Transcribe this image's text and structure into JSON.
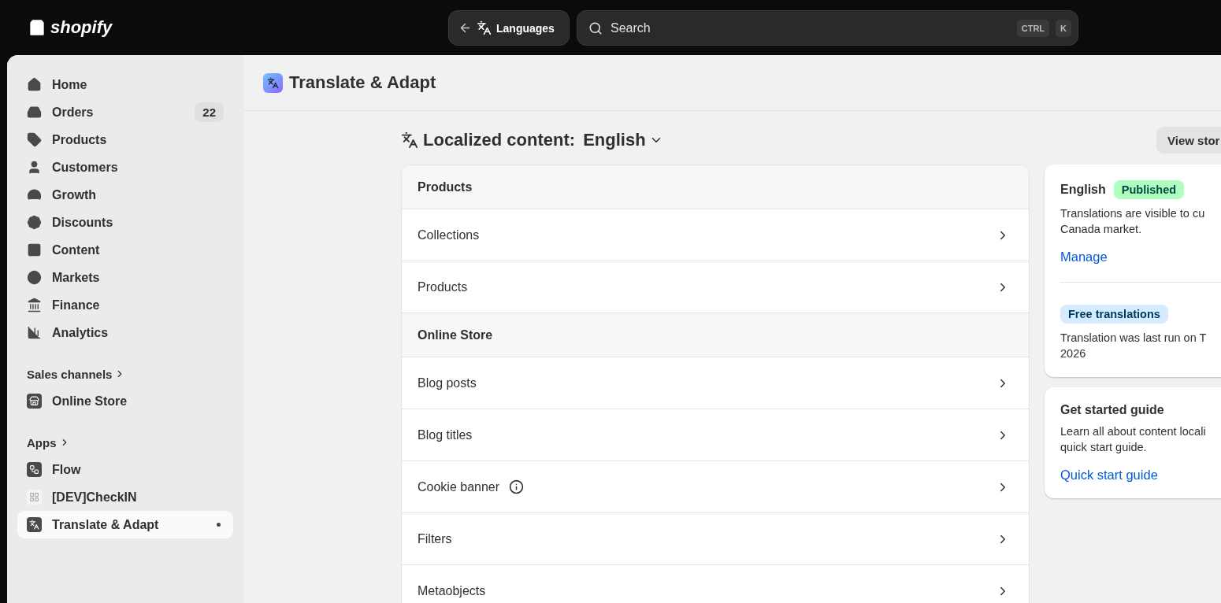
{
  "topbar": {
    "logo": "shopify",
    "back_button": "Languages",
    "search": {
      "placeholder": "Search",
      "keys": [
        "CTRL",
        "K"
      ]
    }
  },
  "sidebar": {
    "items": [
      {
        "label": "Home",
        "selected": false
      },
      {
        "label": "Orders",
        "badge": "22",
        "selected": false
      },
      {
        "label": "Products",
        "selected": false
      },
      {
        "label": "Customers",
        "selected": false
      },
      {
        "label": "Growth",
        "selected": false
      },
      {
        "label": "Discounts",
        "selected": false
      },
      {
        "label": "Content",
        "selected": false
      },
      {
        "label": "Markets",
        "selected": false
      },
      {
        "label": "Finance",
        "selected": false
      },
      {
        "label": "Analytics",
        "selected": false
      }
    ],
    "sections": [
      {
        "title": "Sales channels",
        "items": [
          {
            "label": "Online Store",
            "selected": false
          }
        ]
      },
      {
        "title": "Apps",
        "items": [
          {
            "label": "Flow",
            "selected": false
          },
          {
            "label": "[DEV]CheckIN",
            "selected": false
          },
          {
            "label": "Translate & Adapt",
            "selected": true
          }
        ]
      }
    ]
  },
  "page": {
    "title": "Translate & Adapt",
    "heading": {
      "label": "Localized content:",
      "language": "English"
    },
    "view_button": "View stor",
    "content_list": [
      {
        "kind": "section",
        "label": "Products"
      },
      {
        "kind": "item",
        "label": "Collections"
      },
      {
        "kind": "item",
        "label": "Products"
      },
      {
        "kind": "section",
        "label": "Online Store"
      },
      {
        "kind": "item",
        "label": "Blog posts"
      },
      {
        "kind": "item",
        "label": "Blog titles"
      },
      {
        "kind": "info_item",
        "label": "Cookie banner"
      },
      {
        "kind": "item",
        "label": "Filters"
      },
      {
        "kind": "item",
        "label": "Metaobjects"
      }
    ],
    "language_card": {
      "language": "English",
      "status": "Published",
      "description": "Translations are visible to cu\nCanada market.",
      "link": "Manage",
      "badge": "Free translations",
      "note": "Translation was last run on T\n2026"
    },
    "guide_card": {
      "title": "Get started guide",
      "description": "Learn all about content locali\nquick start guide.",
      "link": "Quick start guide"
    }
  }
}
